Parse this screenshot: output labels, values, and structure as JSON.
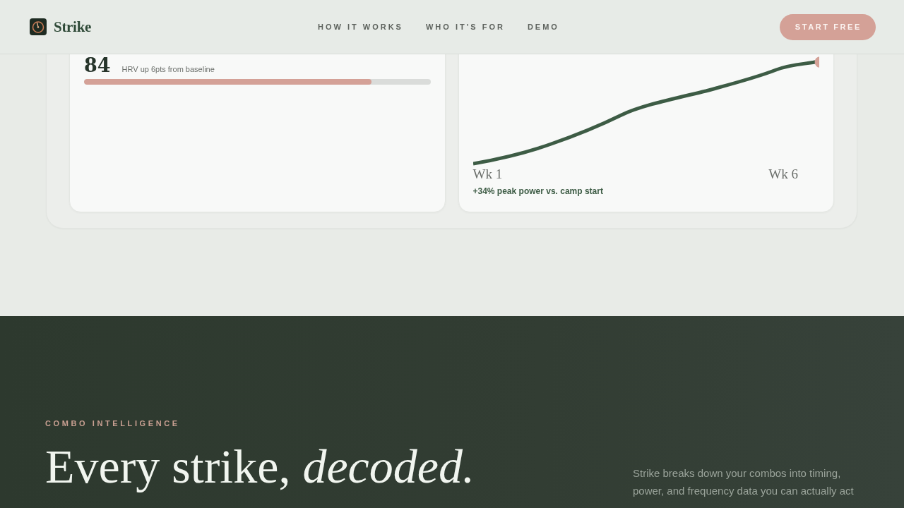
{
  "header": {
    "brand": "Strike",
    "nav": [
      "HOW IT WORKS",
      "WHO IT'S FOR",
      "DEMO"
    ],
    "cta": "START FREE"
  },
  "stat_card": {
    "value": "84",
    "note": "HRV up 6pts from baseline",
    "level": 0.83
  },
  "chart_card": {
    "start_label": "Wk 1",
    "end_label": "Wk 6",
    "caption": "+34% peak power vs. camp start"
  },
  "feature": {
    "eyebrow": "COMBO INTELLIGENCE",
    "heading": "Every strike, *decoded.*",
    "body": "Strike breaks down your combos into timing, power, and frequency data you can actually act"
  }
}
